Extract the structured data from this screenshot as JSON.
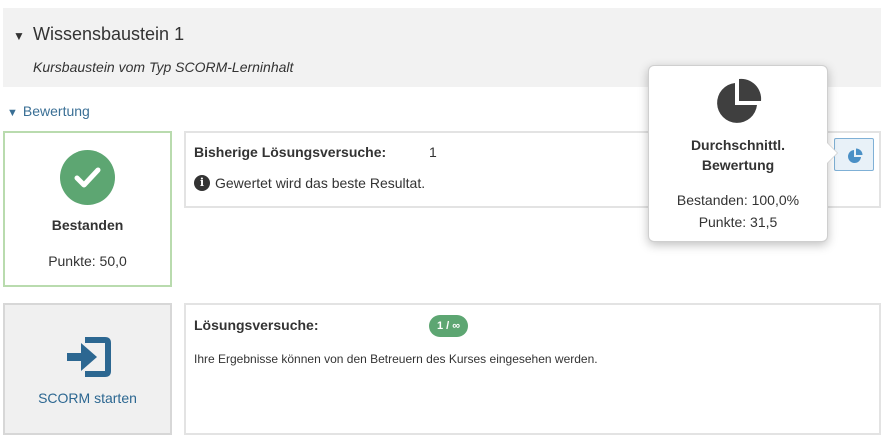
{
  "header": {
    "title": "Wissensbaustein 1",
    "subtitle": "Kursbaustein vom Typ SCORM-Lerninhalt",
    "toggle_glyph": "▼"
  },
  "section": {
    "label": "Bewertung",
    "toggle_glyph": "▼"
  },
  "status": {
    "label": "Bestanden",
    "points": "Punkte: 50,0",
    "icon": "check-icon",
    "color": "#5da672"
  },
  "attempts": {
    "label": "Bisherige Lösungsversuche:",
    "value": "1",
    "info_text": "Gewertet wird das beste Resultat.",
    "info_icon_glyph": "i"
  },
  "average": {
    "title_line1": "Durchschnittl.",
    "title_line2": "Bewertung",
    "passed": "Bestanden: 100,0%",
    "points": "Punkte: 31,5",
    "icon": "pie-chart-icon"
  },
  "launch": {
    "label": "SCORM starten",
    "icon": "sign-in-icon",
    "color": "#2c6791"
  },
  "attempts_info": {
    "label": "Lösungsversuche:",
    "badge": "1 / ∞",
    "note": "Ihre Ergebnisse können von den Betreuern des Kurses eingesehen werden."
  }
}
